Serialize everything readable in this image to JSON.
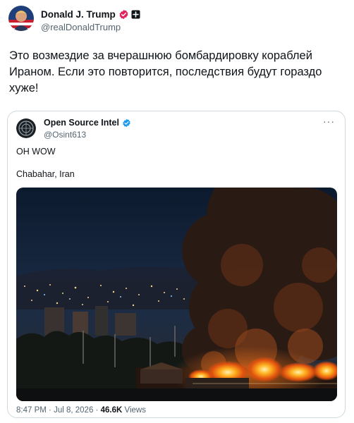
{
  "post": {
    "author_name": "Donald J. Trump",
    "author_handle": "@realDonaldTrump",
    "text": "Это возмездие за вчерашнюю бомбардировку кораблей Ираном. Если это повторится, последствия будут гораздо хуже!",
    "icons": [
      "avatar",
      "verified-badge-icon",
      "government-badge-icon"
    ]
  },
  "quote": {
    "author_name": "Open Source Intel",
    "author_handle": "@Osint613",
    "more_label": "···",
    "line1": "OH WOW",
    "line2": "Chabahar, Iran",
    "meta": {
      "time": "8:47 PM",
      "sep1": "·",
      "date": "Jul 8, 2026",
      "sep2": "·",
      "views_count": "46.6K",
      "views_label": "Views"
    },
    "icons": [
      "verified-badge-icon",
      "more-icon"
    ]
  },
  "colors": {
    "text": "#0f1419",
    "secondary": "#536471",
    "border": "#cfd9de",
    "verified_blue": "#1d9bf0",
    "verified_pink": "#e0245e"
  }
}
